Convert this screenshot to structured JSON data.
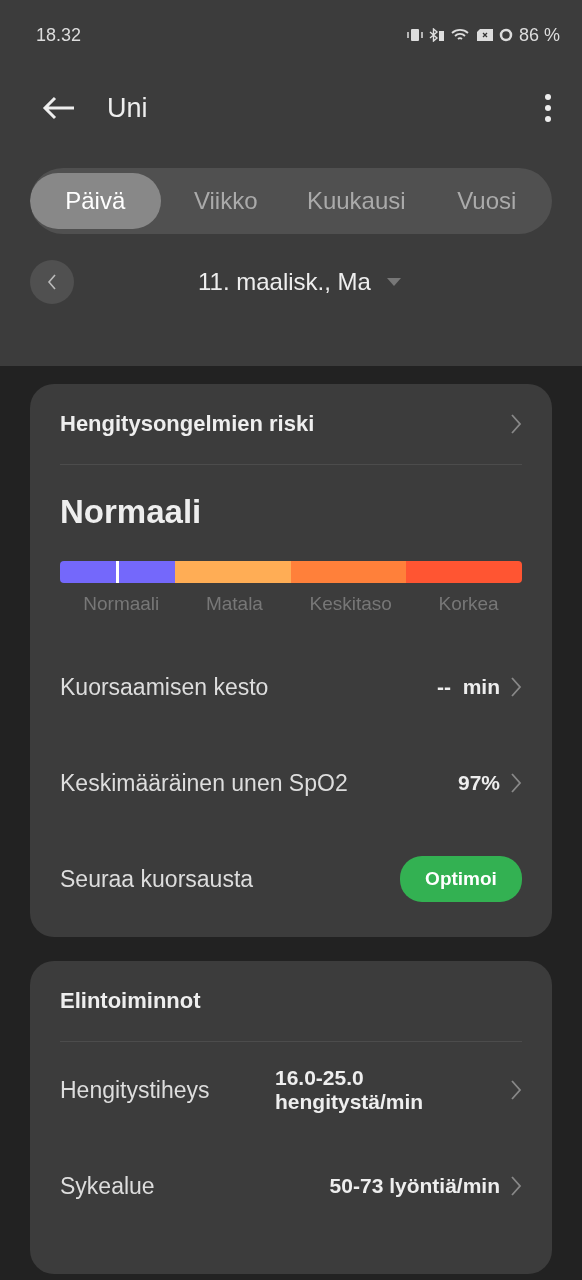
{
  "status_bar": {
    "time": "18.32",
    "battery": "86 %"
  },
  "header": {
    "title": "Uni"
  },
  "tabs": [
    {
      "label": "Päivä",
      "selected": true
    },
    {
      "label": "Viikko",
      "selected": false
    },
    {
      "label": "Kuukausi",
      "selected": false
    },
    {
      "label": "Vuosi",
      "selected": false
    }
  ],
  "date": "11. maalisk., Ma",
  "risk_card": {
    "title": "Hengitysongelmien riski",
    "result": "Normaali",
    "level": 0.123,
    "segments": [
      {
        "label": "Normaali",
        "color": "#7468fb"
      },
      {
        "label": "Matala",
        "color": "#ffad55"
      },
      {
        "label": "Keskitaso",
        "color": "#ff803a"
      },
      {
        "label": "Korkea",
        "color": "#ff5532"
      }
    ],
    "rows": [
      {
        "kind": "value",
        "label": "Kuorsaamisen kesto",
        "value": "--  min"
      },
      {
        "kind": "value",
        "label": "Keskimääräinen unen SpO2",
        "value": "97%"
      },
      {
        "kind": "button",
        "label": "Seuraa kuorsausta",
        "value": "Optimoi"
      }
    ]
  },
  "vitals_card": {
    "title": "Elintoiminnot",
    "rows": [
      {
        "kind": "value",
        "label": "Hengitystiheys",
        "value": "16.0-25.0 hengitystä/min"
      },
      {
        "kind": "value",
        "label": "Sykealue",
        "value": "50-73 lyöntiä/min"
      }
    ]
  }
}
